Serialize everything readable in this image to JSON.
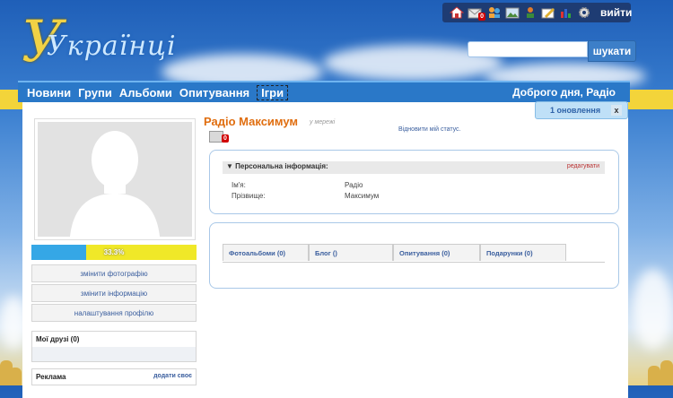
{
  "site": {
    "logo_text": "Українці",
    "logo_letter": "У"
  },
  "toolbar": {
    "logout_label": "вийти",
    "mail_badge": "0"
  },
  "search": {
    "placeholder": "",
    "button_label": "шукати"
  },
  "nav": {
    "items": [
      "Новини",
      "Групи",
      "Альбоми",
      "Опитування",
      "Ігри"
    ],
    "greeting": "Доброго дня, Радіо"
  },
  "updates": {
    "label": "1 оновлення",
    "close": "x"
  },
  "profile": {
    "name": "Радіо Максимум",
    "mood": "у мережі",
    "status_link": "Відновити мій статус.",
    "message_badge": "0",
    "progress_text": "33.3%",
    "progress_fraction": 0.333
  },
  "left_menu": {
    "change_photo": "змінити фотографію",
    "change_info": "змінити інформацію",
    "profile_settings": "налаштування профілю",
    "friends_title": "Мої друзі (0)",
    "ads_title": "Реклама",
    "ads_add": "додати своє"
  },
  "info": {
    "title": "▼ Персональна інформація:",
    "edit_label": "редагувати",
    "first_name_label": "Ім'я:",
    "first_name_value": "Радіо",
    "last_name_label": "Прізвище:",
    "last_name_value": "Максимум"
  },
  "tabs": [
    "Фотоальбоми (0)",
    "Блог ()",
    "Опитування (0)",
    "Подарунки (0)"
  ],
  "colors": {
    "accent": "#2a78c8",
    "name": "#e06e10",
    "yellow": "#f3d43a"
  }
}
